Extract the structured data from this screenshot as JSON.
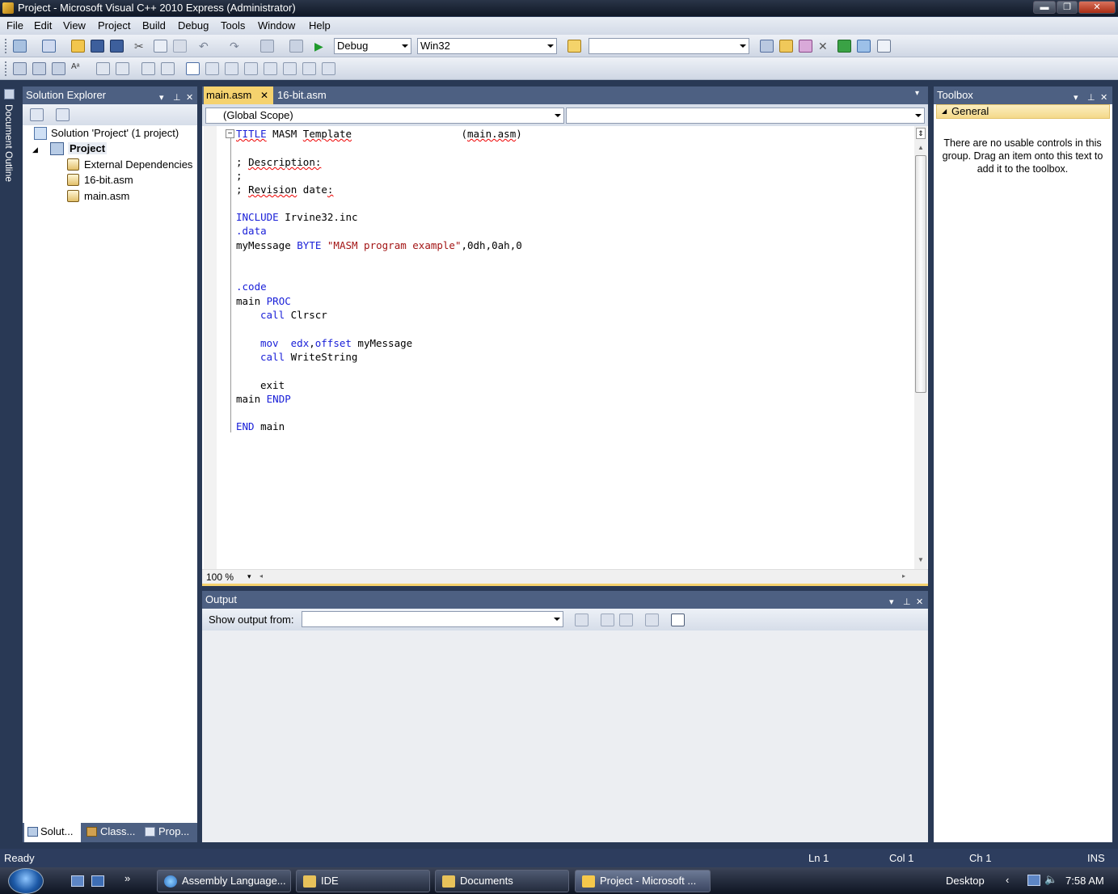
{
  "window": {
    "title": "Project - Microsoft Visual C++ 2010 Express (Administrator)",
    "minimize": "▬",
    "restore": "❐",
    "close": "✕"
  },
  "menu": [
    "File",
    "Edit",
    "View",
    "Project",
    "Build",
    "Debug",
    "Tools",
    "Window",
    "Help"
  ],
  "toolbar": {
    "config": "Debug",
    "platform": "Win32",
    "find": ""
  },
  "side_tab": "Document Outline",
  "solution_explorer": {
    "title": "Solution Explorer",
    "solution": "Solution 'Project' (1 project)",
    "project": "Project",
    "items": [
      "External Dependencies",
      "16-bit.asm",
      "main.asm"
    ],
    "bottom_tabs": [
      "Solut...",
      "Class...",
      "Prop..."
    ]
  },
  "editor": {
    "tabs": [
      "main.asm",
      "16-bit.asm"
    ],
    "scope": "(Global Scope)",
    "zoom": "100 %",
    "code": {
      "l1_kw": "TITLE",
      "l1_a": " MASM ",
      "l1_b": "Template",
      "l1_c": "                  (",
      "l1_d": "main.asm",
      "l1_e": ")",
      "l2_a": "; ",
      "l2_b": "Description:",
      "l3": ";",
      "l4_a": "; ",
      "l4_b": "Revision",
      "l4_c": " date",
      "l4_d": ":",
      "l5_kw": "INCLUDE",
      "l5_a": " Irvine32.inc",
      "l6": ".data",
      "l7_a": "myMessage ",
      "l7_kw": "BYTE",
      "l7_b": " ",
      "l7_str": "\"MASM program example\"",
      "l7_c": ",0dh,0ah,0",
      "l8": ".code",
      "l9_a": "main ",
      "l9_kw": "PROC",
      "l10_kw": "call",
      "l10_a": " Clrscr",
      "l11_kw": "mov",
      "l11_b": "  ",
      "l11_kw2": "edx",
      "l11_c": ",",
      "l11_kw3": "offset",
      "l11_d": " myMessage",
      "l12_kw": "call",
      "l12_a": " WriteString",
      "l13": "exit",
      "l14_a": "main ",
      "l14_kw": "ENDP",
      "l15_kw": "END",
      "l15_a": " main"
    }
  },
  "output": {
    "title": "Output",
    "show_from_label": "Show output from:",
    "source": ""
  },
  "toolbox": {
    "title": "Toolbox",
    "group": "General",
    "message": "There are no usable controls in this group. Drag an item onto this text to add it to the toolbox."
  },
  "status": {
    "ready": "Ready",
    "ln": "Ln 1",
    "col": "Col 1",
    "ch": "Ch 1",
    "ins": "INS"
  },
  "taskbar": {
    "items": [
      "Assembly Language...",
      "IDE",
      "Documents",
      "Project - Microsoft ..."
    ],
    "desktop": "Desktop",
    "clock": "7:58 AM",
    "chevron": "»"
  },
  "colors": {
    "accent": "#f5d26e",
    "panel_bg": "#293955",
    "statusbar": "#2d3d5e"
  }
}
